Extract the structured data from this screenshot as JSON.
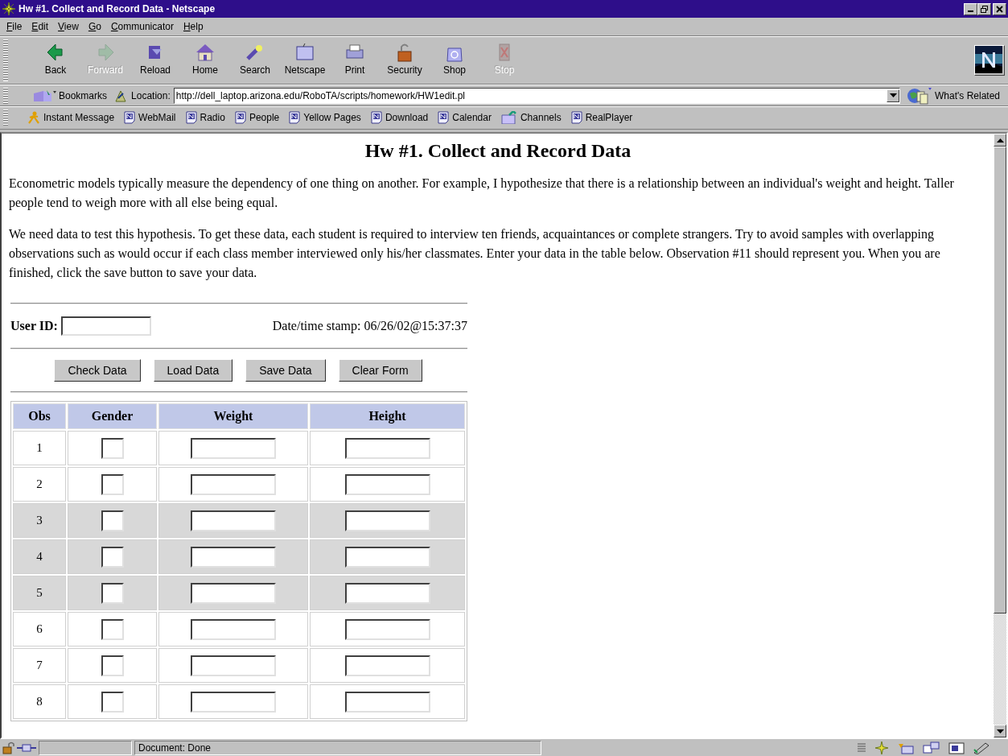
{
  "window": {
    "title": "Hw #1. Collect and Record Data - Netscape"
  },
  "menu": [
    "File",
    "Edit",
    "View",
    "Go",
    "Communicator",
    "Help"
  ],
  "toolbar": [
    {
      "label": "Back",
      "disabled": false
    },
    {
      "label": "Forward",
      "disabled": true
    },
    {
      "label": "Reload",
      "disabled": false
    },
    {
      "label": "Home",
      "disabled": false
    },
    {
      "label": "Search",
      "disabled": false
    },
    {
      "label": "Netscape",
      "disabled": false
    },
    {
      "label": "Print",
      "disabled": false
    },
    {
      "label": "Security",
      "disabled": false
    },
    {
      "label": "Shop",
      "disabled": false
    },
    {
      "label": "Stop",
      "disabled": true
    }
  ],
  "location": {
    "bookmarks": "Bookmarks",
    "label": "Location:",
    "url": "http://dell_laptop.arizona.edu/RoboTA/scripts/homework/HW1edit.pl",
    "related": "What's Related"
  },
  "personal_toolbar": [
    "Instant Message",
    "WebMail",
    "Radio",
    "People",
    "Yellow Pages",
    "Download",
    "Calendar",
    "Channels",
    "RealPlayer"
  ],
  "page": {
    "heading": "Hw #1. Collect and Record Data",
    "paragraphs": [
      "Econometric models typically measure the dependency of one thing on another. For example, I hypothesize that there is a relationship between an individual's weight and height. Taller people tend to weigh more with all else being equal.",
      "We need data to test this hypothesis. To get these data, each student is required to interview ten friends, acquaintances or complete strangers. Try to avoid samples with overlapping observations such as would occur if each class member interviewed only his/her classmates. Enter your data in the table below. Observation #11 should represent you. When you are finished, click the save button to save your data."
    ],
    "user_id_label": "User ID:",
    "timestamp": "Date/time stamp: 06/26/02@15:37:37",
    "buttons": [
      "Check Data",
      "Load Data",
      "Save Data",
      "Clear Form"
    ],
    "table": {
      "columns": [
        "Obs",
        "Gender",
        "Weight",
        "Height"
      ],
      "rows": [
        {
          "obs": "1",
          "shaded": false
        },
        {
          "obs": "2",
          "shaded": false
        },
        {
          "obs": "3",
          "shaded": true
        },
        {
          "obs": "4",
          "shaded": true
        },
        {
          "obs": "5",
          "shaded": true
        },
        {
          "obs": "6",
          "shaded": false
        },
        {
          "obs": "7",
          "shaded": false
        },
        {
          "obs": "8",
          "shaded": false
        }
      ]
    }
  },
  "status_bar": {
    "text": "Document: Done"
  }
}
